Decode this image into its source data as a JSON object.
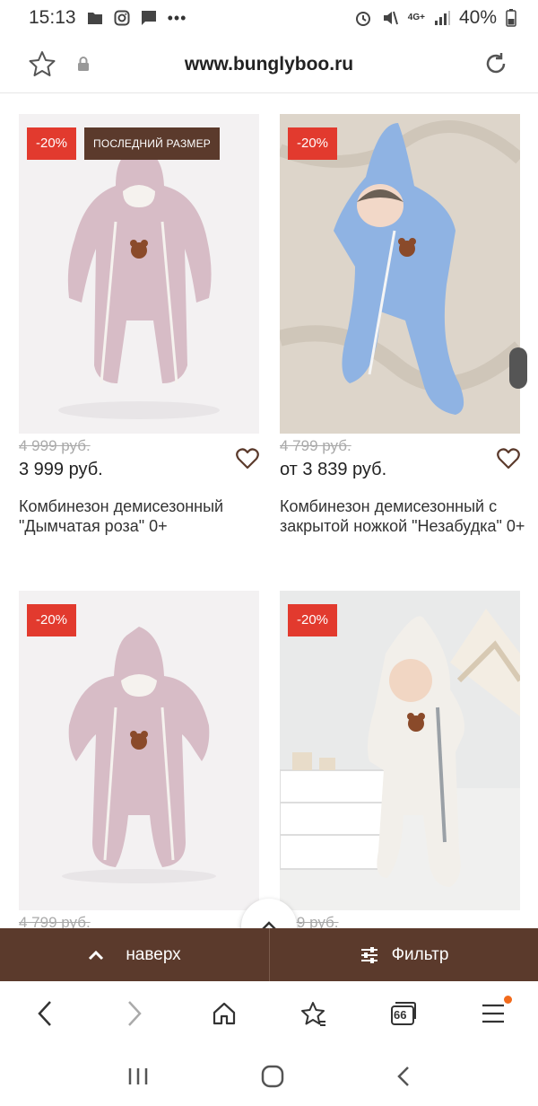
{
  "status_bar": {
    "time": "15:13",
    "network": "4G+",
    "battery": "40%"
  },
  "browser": {
    "url": "www.bunglyboo.ru",
    "tab_count": "66"
  },
  "products": [
    {
      "discount": "-20%",
      "tag": "ПОСЛЕДНИЙ РАЗМЕР",
      "old_price": "4 999 руб.",
      "price": "3 999 руб.",
      "name": "Комбинезон демисезонный \"Дымчатая роза\" 0+",
      "image": "pink-jumpsuit"
    },
    {
      "discount": "-20%",
      "old_price": "4 799 руб.",
      "price": "от 3 839 руб.",
      "name": "Комбинезон демисезонный с закрытой ножкой \"Незабудка\" 0+",
      "image": "blue-jumpsuit-baby"
    },
    {
      "discount": "-20%",
      "old_price": "4 799 руб.",
      "image": "pink-jumpsuit-closed-feet"
    },
    {
      "discount": "-20%",
      "old_price": "899 руб.",
      "image": "white-jumpsuit-baby"
    }
  ],
  "bottom_bar": {
    "up_label": "наверх",
    "filter_label": "Фильтр"
  },
  "colors": {
    "brand_brown": "#5b3a2c",
    "discount_red": "#e23a2e"
  }
}
